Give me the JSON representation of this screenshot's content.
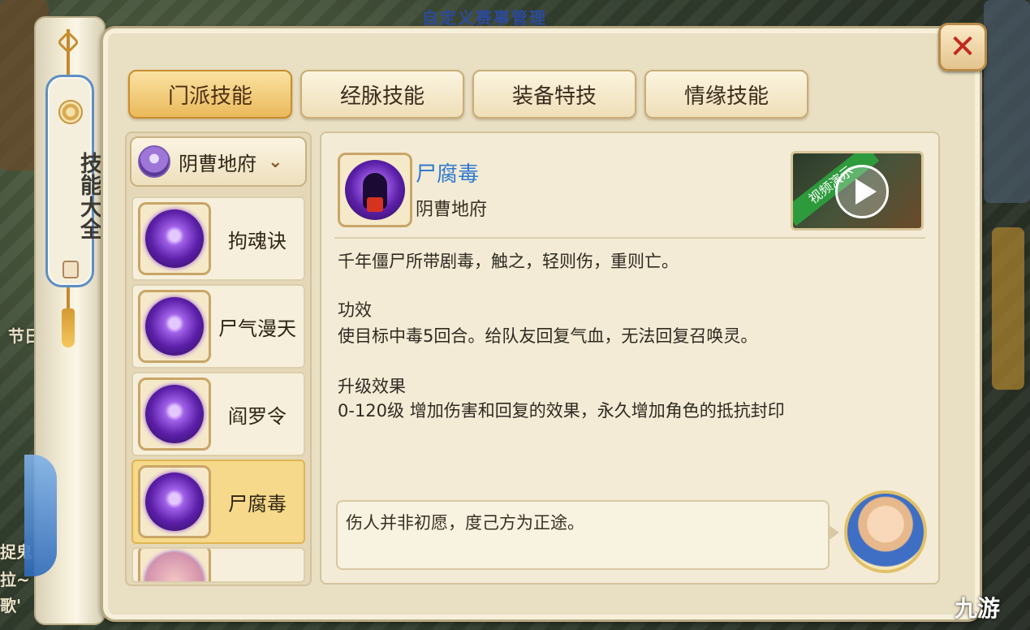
{
  "background": {
    "top_text": "自定义赛事管理",
    "side_text_1": "节日",
    "side_text_2": "捉鬼",
    "side_text_3": "拉~",
    "side_text_4": "歌'"
  },
  "scroll": {
    "title": "技能大全"
  },
  "close_label": "✕",
  "tabs": [
    {
      "label": "门派技能",
      "active": true
    },
    {
      "label": "经脉技能",
      "active": false
    },
    {
      "label": "装备特技",
      "active": false
    },
    {
      "label": "情缘技能",
      "active": false
    }
  ],
  "sect_selector": {
    "label": "阴曹地府",
    "chevron": "⌄"
  },
  "skills": [
    {
      "name": "拘魂诀",
      "icon": "skull-spirit-icon"
    },
    {
      "name": "尸气漫天",
      "icon": "ghost-mist-icon"
    },
    {
      "name": "阎罗令",
      "icon": "hell-token-icon"
    },
    {
      "name": "尸腐毒",
      "icon": "corpse-poison-icon",
      "selected": true
    }
  ],
  "detail": {
    "name": "尸腐毒",
    "sect": "阴曹地府",
    "video_label": "视频演示",
    "lore": "千年僵尸所带剧毒，触之，轻则伤，重则亡。",
    "effect_heading": "功效",
    "effect_text": "使目标中毒5回合。给队友回复气血，无法回复召唤灵。",
    "upgrade_heading": "升级效果",
    "upgrade_text": "0-120级 增加伤害和回复的效果，永久增加角色的抵抗封印"
  },
  "quote": "伤人并非初愿，度己方为正途。",
  "watermark": "九游",
  "colors": {
    "skill_title": "#2f7ad1",
    "active_tab": "#eab95b",
    "close_x": "#c3281d"
  }
}
